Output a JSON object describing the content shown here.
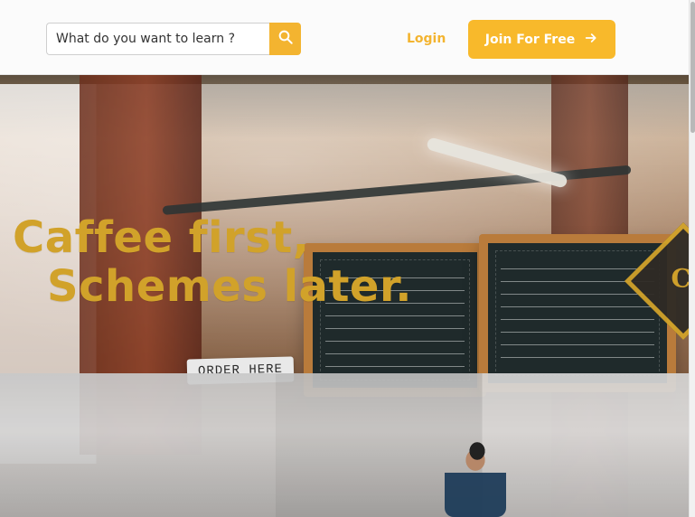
{
  "header": {
    "search": {
      "placeholder": "What do you want to learn ?",
      "value": ""
    },
    "login_label": "Login",
    "join_label": "Join For Free"
  },
  "hero": {
    "headline_line1": "Caffee first,",
    "headline_line2": "Schemes later.",
    "order_sign": "ORDER HERE",
    "diamond_letter": "C"
  },
  "icons": {
    "search": "search-icon",
    "arrow": "arrow-right-icon"
  },
  "colors": {
    "accent": "#f3b430",
    "hero_text": "#d1a22a"
  }
}
